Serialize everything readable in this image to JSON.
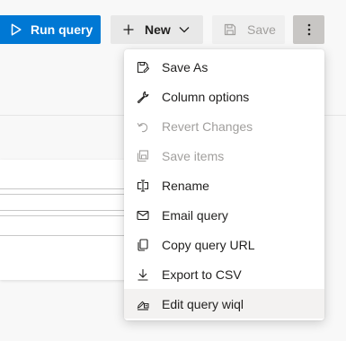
{
  "toolbar": {
    "run_label": "Run query",
    "new_label": "New",
    "save_label": "Save"
  },
  "menu": {
    "items": [
      {
        "label": "Save As",
        "icon": "save-as-icon",
        "disabled": false
      },
      {
        "label": "Column options",
        "icon": "wrench-icon",
        "disabled": false
      },
      {
        "label": "Revert Changes",
        "icon": "undo-icon",
        "disabled": true
      },
      {
        "label": "Save items",
        "icon": "save-items-icon",
        "disabled": true
      },
      {
        "label": "Rename",
        "icon": "rename-icon",
        "disabled": false
      },
      {
        "label": "Email query",
        "icon": "mail-icon",
        "disabled": false
      },
      {
        "label": "Copy query URL",
        "icon": "copy-icon",
        "disabled": false
      },
      {
        "label": "Export to CSV",
        "icon": "download-icon",
        "disabled": false
      },
      {
        "label": "Edit query wiql",
        "icon": "edit-wiql-icon",
        "disabled": false,
        "hovered": true
      }
    ]
  },
  "colors": {
    "accent": "#0078d4",
    "disabled_text": "#a19f9d",
    "hover_bg": "#f3f2f1"
  }
}
